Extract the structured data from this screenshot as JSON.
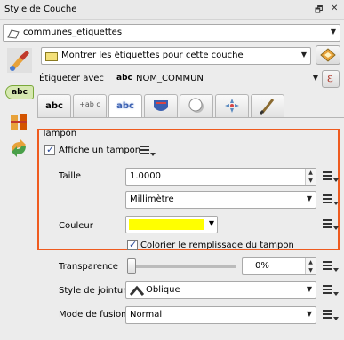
{
  "window": {
    "title": "Style de Couche",
    "float_btn": "🗗",
    "close_btn": "✕"
  },
  "layer_combo": {
    "value": "communes_etiquettes"
  },
  "label_mode": {
    "value": "Montrer les étiquettes pour cette couche"
  },
  "label_with": {
    "label": "Étiqueter avec",
    "value": "NOM_COMMUN",
    "prefix": "abc",
    "expr_btn": "ε"
  },
  "sidebar_badge": "abc",
  "tabs": [
    {
      "label": "abc",
      "name": "tab-text"
    },
    {
      "label": "+ab c",
      "name": "tab-formatting"
    },
    {
      "label": "abc",
      "name": "tab-buffer"
    },
    {
      "label": "",
      "name": "tab-background"
    },
    {
      "label": "",
      "name": "tab-shadow"
    },
    {
      "label": "",
      "name": "tab-placement"
    },
    {
      "label": "",
      "name": "tab-rendering"
    }
  ],
  "buffer": {
    "section_title": "Tampon",
    "draw_label": "Affiche un tampon",
    "draw_checked": true,
    "size_label": "Taille",
    "size_value": "1.0000",
    "unit_value": "Millimètre",
    "color_label": "Couleur",
    "color_hex": "#ffff00",
    "fill_label": "Colorier le remplissage du tampon",
    "fill_checked": true,
    "transparency_label": "Transparence",
    "transparency_value": "0%",
    "transparency_level": 0,
    "join_label": "Style de jointure",
    "join_value": "Oblique",
    "blend_label": "Mode de fusion",
    "blend_value": "Normal"
  },
  "colors": {
    "highlight": "#ef5b1f",
    "buffer_yellow": "#ffff00",
    "active_tab": "#ffffff"
  }
}
